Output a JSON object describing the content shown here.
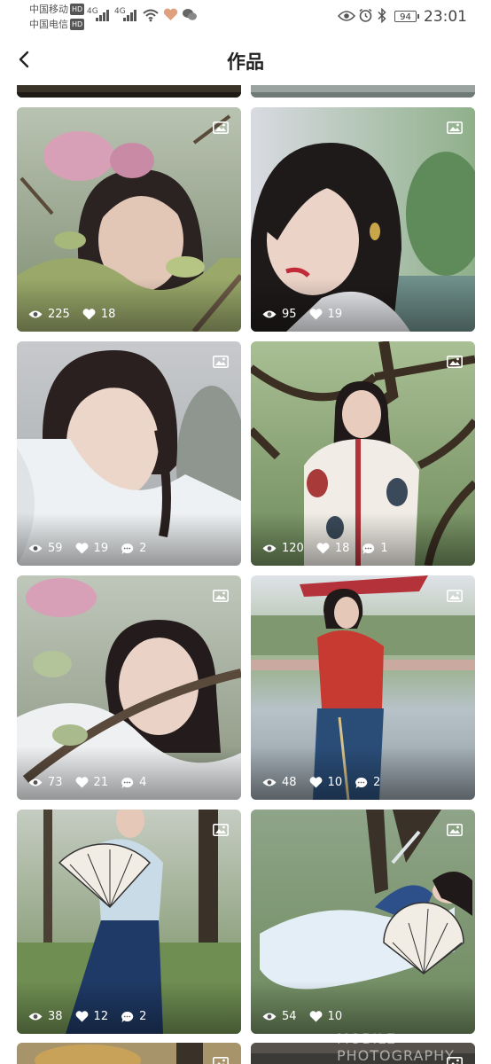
{
  "status_bar": {
    "carrier1": "中国移动",
    "carrier2": "中国电信",
    "hd": "HD",
    "net1": "4G",
    "net2": "4G",
    "battery": "94",
    "time": "23:01"
  },
  "header": {
    "title": "作品"
  },
  "photos": [
    {
      "views": "225",
      "likes": "18",
      "comments": ""
    },
    {
      "views": "95",
      "likes": "19",
      "comments": ""
    },
    {
      "views": "59",
      "likes": "19",
      "comments": "2"
    },
    {
      "views": "120",
      "likes": "18",
      "comments": "1"
    },
    {
      "views": "73",
      "likes": "21",
      "comments": "4"
    },
    {
      "views": "48",
      "likes": "10",
      "comments": "2"
    },
    {
      "views": "38",
      "likes": "12",
      "comments": "2"
    },
    {
      "views": "54",
      "likes": "10",
      "comments": ""
    }
  ],
  "watermark": "MOBILE PHOTOGRAPHY",
  "colors": {
    "accent": "#ffffff",
    "text": "#222222",
    "status": "#555555"
  },
  "icons": {
    "back": "chevron-left-icon",
    "views": "eye-icon",
    "likes": "heart-icon",
    "comments": "comment-bubble-icon",
    "type": "image-icon"
  }
}
